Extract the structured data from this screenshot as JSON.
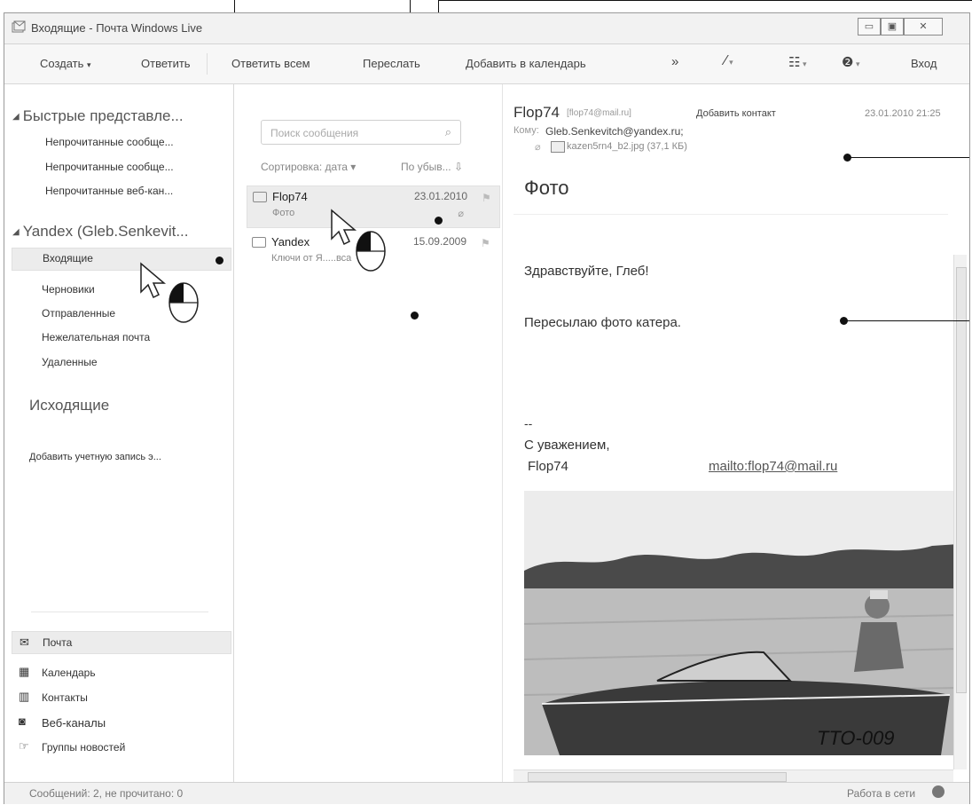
{
  "window": {
    "title": "Входящие - Почта Windows Live",
    "min": "▭",
    "max": "▣",
    "close": "✕"
  },
  "toolbar": {
    "create": "Создать",
    "reply": "Ответить",
    "reply_all": "Ответить всем",
    "forward": "Переслать",
    "add_calendar": "Добавить в календарь",
    "more": "»",
    "signin": "Вход"
  },
  "sidebar": {
    "quick_views": "Быстрые представле...",
    "quick_items": [
      "Непрочитанные сообще...",
      "Непрочитанные сообще...",
      "Непрочитанные веб-кан..."
    ],
    "account": "Yandex (Gleb.Senkevit...",
    "folders": [
      "Входящие",
      "Черновики",
      "Отправленные",
      "Нежелательная почта",
      "Удаленные"
    ],
    "outbox": "Исходящие",
    "add_account": "Добавить учетную запись э...",
    "nav": [
      "Почта",
      "Календарь",
      "Контакты",
      "Веб-каналы",
      "Группы новостей"
    ]
  },
  "list": {
    "search_placeholder": "Поиск сообщения",
    "sort_label": "Сортировка: дата ▾",
    "order_label": "По убыв... ⇩",
    "messages": [
      {
        "from": "Flop74",
        "subject": "Фото",
        "date": "23.01.2010"
      },
      {
        "from": "Yandex",
        "subject": "Ключи от Я.....вса",
        "date": "15.09.2009"
      }
    ]
  },
  "reading": {
    "sender_name": "Flop74",
    "sender_email": "[flop74@mail.ru]",
    "add_contact": "Добавить контакт",
    "datetime": "23.01.2010 21:25",
    "to_label": "Кому:",
    "to_value": "Gleb.Senkevitch@yandex.ru;",
    "attachment": "kazen5rn4_b2.jpg (37,1 КБ)",
    "subject": "Фото",
    "body_lines": [
      "Здравствуйте, Глеб!",
      "Пересылаю фото катера."
    ],
    "sig_dash": "--",
    "sig_regards": "С уважением,",
    "sig_name": "Flop74",
    "sig_link": "mailto:flop74@mail.ru",
    "boat_number": "ТТО-009"
  },
  "status": {
    "left": "Сообщений: 2, не прочитано: 0",
    "right": "Работа в сети"
  }
}
